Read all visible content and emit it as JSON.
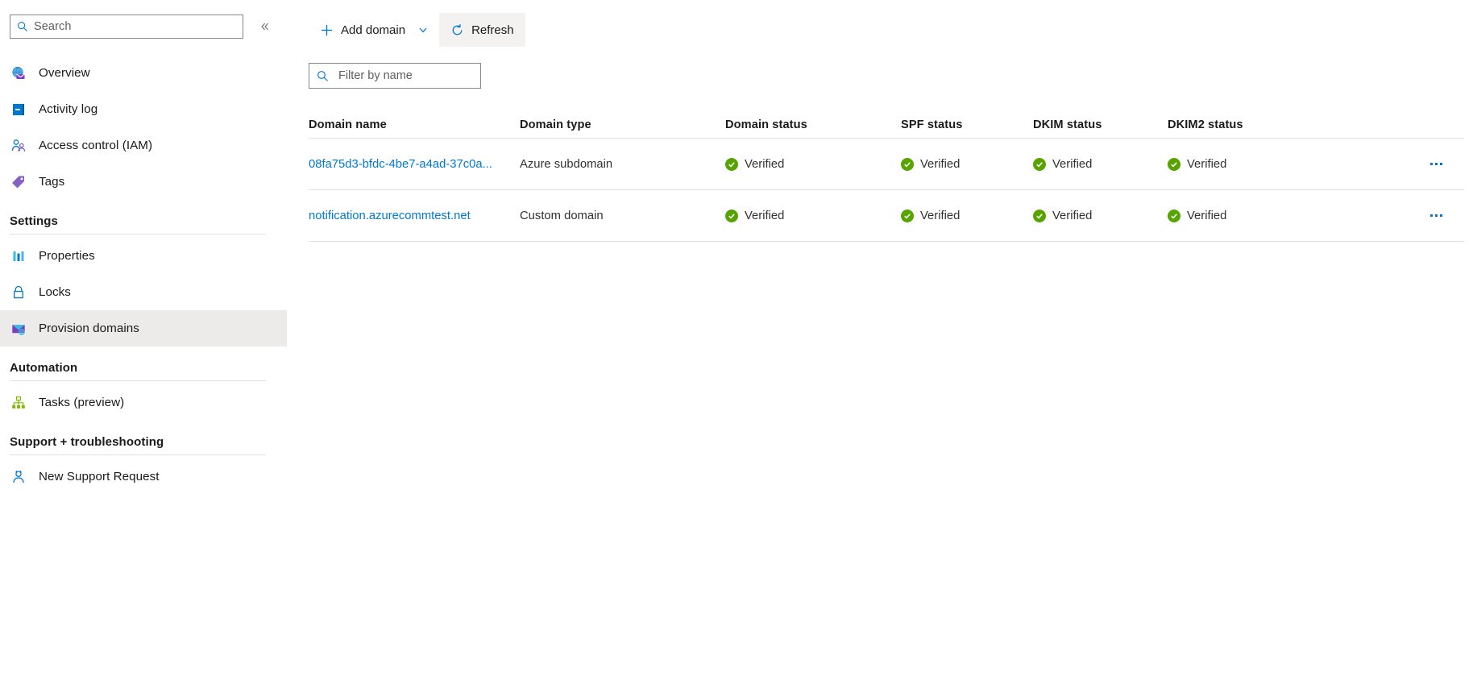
{
  "sidebar": {
    "search": {
      "placeholder": "Search",
      "icon": "search-icon"
    },
    "collapse": {
      "icon": "chevron-double-left-icon",
      "label": "«"
    },
    "top_items": [
      {
        "label": "Overview",
        "icon": "overview-email-icon",
        "selected": false
      },
      {
        "label": "Activity log",
        "icon": "activity-log-icon",
        "selected": false
      },
      {
        "label": "Access control (IAM)",
        "icon": "access-control-people-icon",
        "selected": false
      },
      {
        "label": "Tags",
        "icon": "tag-icon",
        "selected": false
      }
    ],
    "groups": [
      {
        "title": "Settings",
        "items": [
          {
            "label": "Properties",
            "icon": "properties-bars-icon",
            "selected": false
          },
          {
            "label": "Locks",
            "icon": "lock-icon",
            "selected": false
          },
          {
            "label": "Provision domains",
            "icon": "provision-domains-envelope-icon",
            "selected": true
          }
        ]
      },
      {
        "title": "Automation",
        "items": [
          {
            "label": "Tasks (preview)",
            "icon": "tasks-hierarchy-icon",
            "selected": false
          }
        ]
      },
      {
        "title": "Support + troubleshooting",
        "items": [
          {
            "label": "New Support Request",
            "icon": "support-person-icon",
            "selected": false
          }
        ]
      }
    ]
  },
  "toolbar": {
    "add_domain_label": "Add domain",
    "add_domain_icon": "plus-icon",
    "add_domain_chevron_icon": "chevron-down-icon",
    "refresh_label": "Refresh",
    "refresh_icon": "refresh-circular-arrow-icon"
  },
  "filter": {
    "placeholder": "Filter by name",
    "value": "",
    "icon": "search-icon"
  },
  "table": {
    "columns": [
      "Domain name",
      "Domain type",
      "Domain status",
      "SPF status",
      "DKIM status",
      "DKIM2 status"
    ],
    "rows": [
      {
        "domain_name": "08fa75d3-bfdc-4be7-a4ad-37c0a...",
        "domain_type": "Azure subdomain",
        "domain_status": "Verified",
        "spf_status": "Verified",
        "dkim_status": "Verified",
        "dkim2_status": "Verified",
        "menu_icon": "ellipsis-horizontal-icon"
      },
      {
        "domain_name": "notification.azurecommtest.net",
        "domain_type": "Custom domain",
        "domain_status": "Verified",
        "spf_status": "Verified",
        "dkim_status": "Verified",
        "dkim2_status": "Verified",
        "menu_icon": "ellipsis-horizontal-icon"
      }
    ]
  },
  "colors": {
    "accent_blue": "#0078d4",
    "link_blue": "#0078d4",
    "status_green": "#57a300",
    "selected_gray": "#edebe9",
    "border_gray": "#e1dfdd"
  }
}
